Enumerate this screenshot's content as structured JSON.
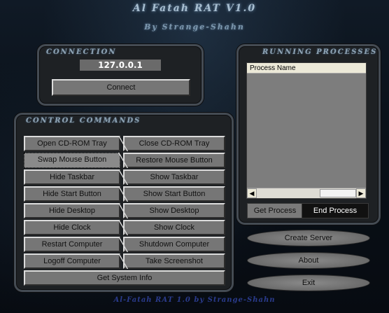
{
  "window": {
    "title": "Al Fatah RAT V1.0",
    "subtitle": "By Strange-Shahn"
  },
  "connection": {
    "title": "Connection",
    "ip_value": "127.0.0.1",
    "connect_label": "Connect"
  },
  "control": {
    "title": "Control Commands",
    "rows": [
      {
        "left": "Open CD-ROM Tray",
        "right": "Close CD-ROM Tray"
      },
      {
        "left": "Swap Mouse Button",
        "right": "Restore Mouse Button"
      },
      {
        "left": "Hide Taskbar",
        "right": "Show Taskbar"
      },
      {
        "left": "Hide Start Button",
        "right": "Show Start Button"
      },
      {
        "left": "Hide Desktop",
        "right": "Show Desktop"
      },
      {
        "left": "Hide Clock",
        "right": "Show Clock"
      },
      {
        "left": "Restart Computer",
        "right": "Shutdown Computer"
      },
      {
        "left": "Logoff Computer",
        "right": "Take Screenshot"
      }
    ],
    "system_info_label": "Get System Info"
  },
  "processes": {
    "title": "Running Processes",
    "column_header": "Process Name",
    "get_label": "Get Process",
    "end_label": "End Process"
  },
  "actions": {
    "create_server": "Create Server",
    "about": "About",
    "exit": "Exit"
  },
  "footer": "Al-Fatah RAT 1.0 by Strange-Shahn",
  "colors": {
    "panel_border": "#444b53",
    "button_face": "#767676",
    "footer_text": "#2a3b8c"
  }
}
